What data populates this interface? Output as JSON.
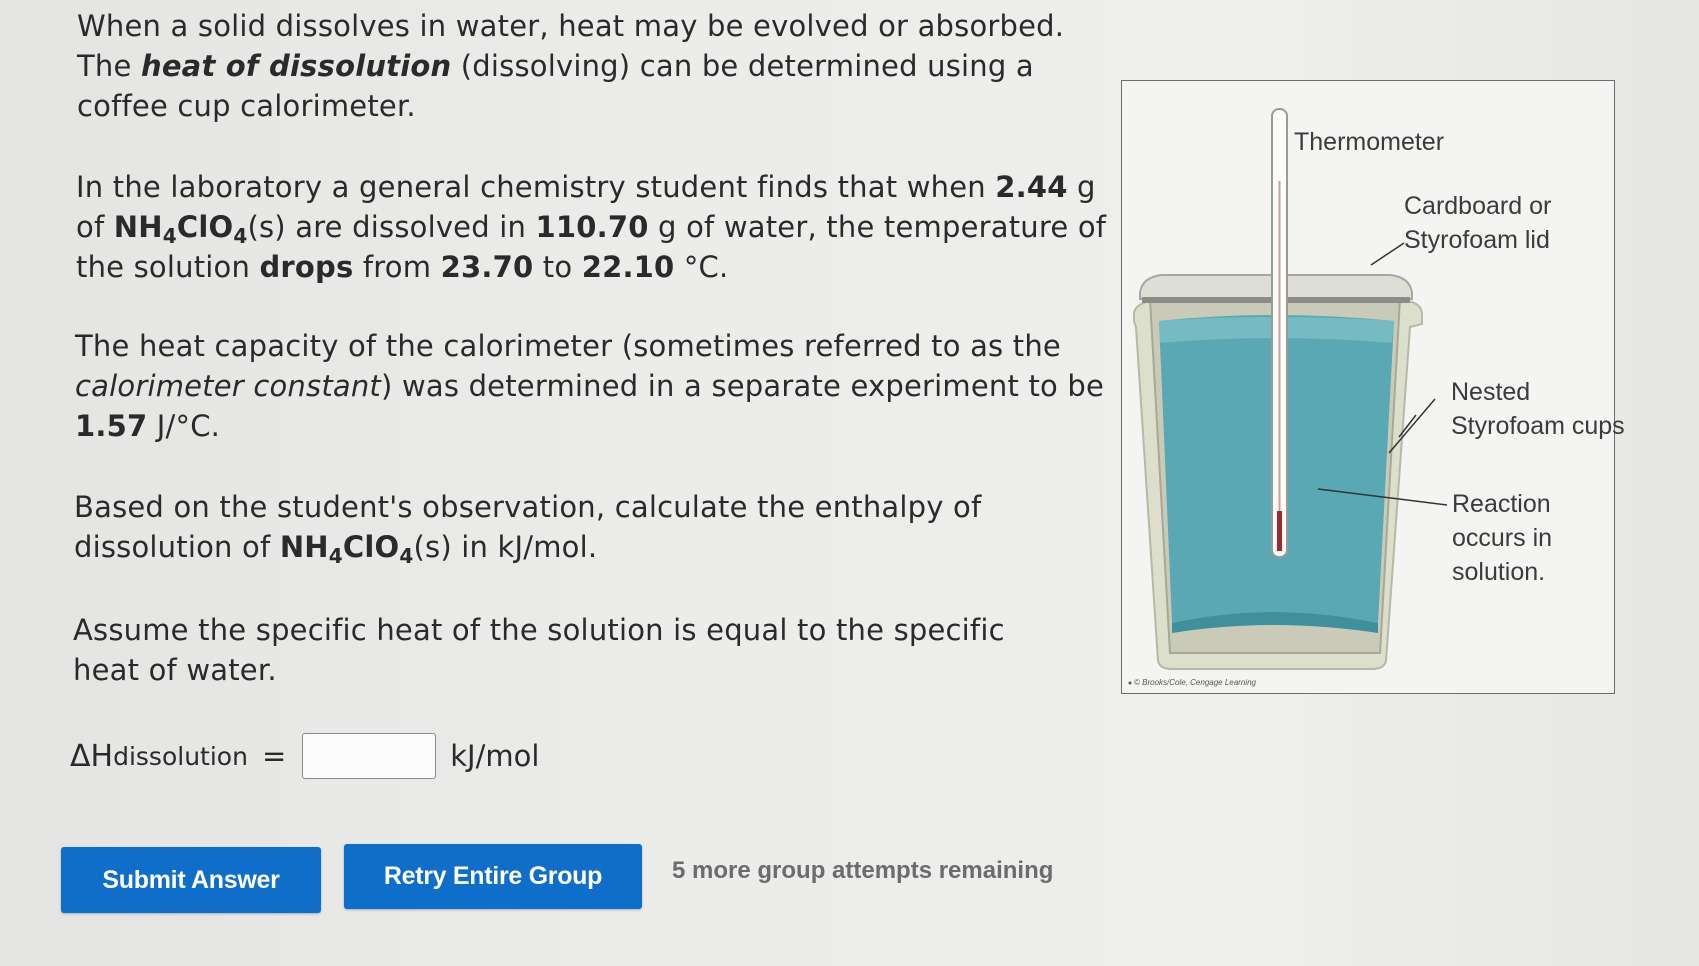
{
  "problem": {
    "p1": {
      "a": "When a solid dissolves in water, heat may be evolved or absorbed. The ",
      "b": "heat of dissolution",
      "c": " (dissolving) can be determined using a coffee cup calorimeter."
    },
    "p2": {
      "a": "In the laboratory a general chemistry student finds that when ",
      "mass": "2.44",
      "b": " g of ",
      "compound_main": "NH",
      "compound_sub1": "4",
      "compound_mid": "ClO",
      "compound_sub2": "4",
      "c": "(s) are dissolved in ",
      "water_mass": "110.70",
      "d": " g of water, the temperature of the solution ",
      "direction": "drops",
      "e": " from ",
      "t1": "23.70",
      "f": " to ",
      "t2": "22.10",
      "g": " °C."
    },
    "p3": {
      "a": "The heat capacity of the calorimeter (sometimes referred to as the ",
      "term": "calorimeter constant",
      "b": ") was determined in a separate experiment to be ",
      "value": "1.57",
      "c": " J/°C."
    },
    "p4": {
      "a": "Based on the student's observation, calculate the enthalpy of dissolution of ",
      "compound_main": "NH",
      "compound_sub1": "4",
      "compound_mid": "ClO",
      "compound_sub2": "4",
      "b": "(s) in kJ/mol."
    },
    "p5": "Assume the specific heat of the solution is equal to the specific heat of water."
  },
  "answer": {
    "symbol": "ΔH",
    "subscript": "dissolution",
    "equals": "=",
    "value": "",
    "unit": "kJ/mol"
  },
  "buttons": {
    "submit": "Submit Answer",
    "retry": "Retry Entire Group"
  },
  "attempts_text": "5 more group attempts remaining",
  "figure": {
    "thermometer": "Thermometer",
    "lid_line1": "Cardboard or",
    "lid_line2": "Styrofoam lid",
    "cups_line1": "Nested",
    "cups_line2": "Styrofoam cups",
    "reaction_line1": "Reaction",
    "reaction_line2": "occurs in",
    "reaction_line3": "solution.",
    "credit": "© Brooks/Cole, Cengage Learning"
  },
  "colors": {
    "button": "#0e6ec9",
    "solution": "#5aa8b4",
    "cup": "#d9dcc8"
  }
}
